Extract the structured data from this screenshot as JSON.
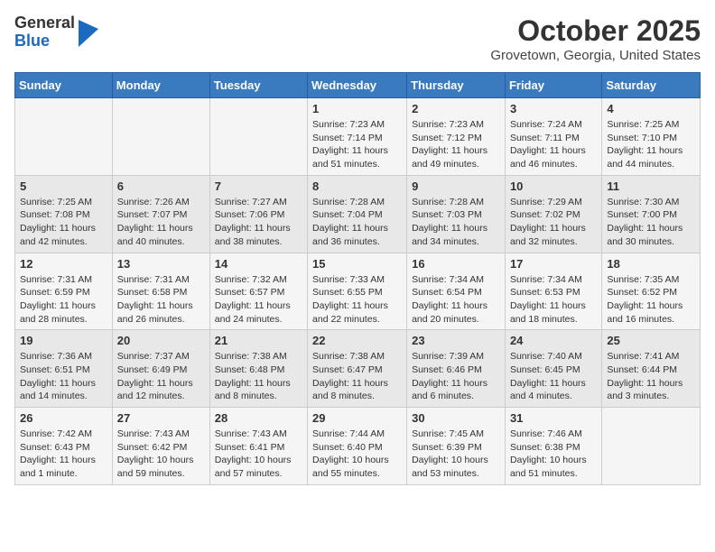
{
  "header": {
    "logo_general": "General",
    "logo_blue": "Blue",
    "month": "October 2025",
    "location": "Grovetown, Georgia, United States"
  },
  "days_of_week": [
    "Sunday",
    "Monday",
    "Tuesday",
    "Wednesday",
    "Thursday",
    "Friday",
    "Saturday"
  ],
  "weeks": [
    [
      {
        "day": "",
        "content": ""
      },
      {
        "day": "",
        "content": ""
      },
      {
        "day": "",
        "content": ""
      },
      {
        "day": "1",
        "content": "Sunrise: 7:23 AM\nSunset: 7:14 PM\nDaylight: 11 hours and 51 minutes."
      },
      {
        "day": "2",
        "content": "Sunrise: 7:23 AM\nSunset: 7:12 PM\nDaylight: 11 hours and 49 minutes."
      },
      {
        "day": "3",
        "content": "Sunrise: 7:24 AM\nSunset: 7:11 PM\nDaylight: 11 hours and 46 minutes."
      },
      {
        "day": "4",
        "content": "Sunrise: 7:25 AM\nSunset: 7:10 PM\nDaylight: 11 hours and 44 minutes."
      }
    ],
    [
      {
        "day": "5",
        "content": "Sunrise: 7:25 AM\nSunset: 7:08 PM\nDaylight: 11 hours and 42 minutes."
      },
      {
        "day": "6",
        "content": "Sunrise: 7:26 AM\nSunset: 7:07 PM\nDaylight: 11 hours and 40 minutes."
      },
      {
        "day": "7",
        "content": "Sunrise: 7:27 AM\nSunset: 7:06 PM\nDaylight: 11 hours and 38 minutes."
      },
      {
        "day": "8",
        "content": "Sunrise: 7:28 AM\nSunset: 7:04 PM\nDaylight: 11 hours and 36 minutes."
      },
      {
        "day": "9",
        "content": "Sunrise: 7:28 AM\nSunset: 7:03 PM\nDaylight: 11 hours and 34 minutes."
      },
      {
        "day": "10",
        "content": "Sunrise: 7:29 AM\nSunset: 7:02 PM\nDaylight: 11 hours and 32 minutes."
      },
      {
        "day": "11",
        "content": "Sunrise: 7:30 AM\nSunset: 7:00 PM\nDaylight: 11 hours and 30 minutes."
      }
    ],
    [
      {
        "day": "12",
        "content": "Sunrise: 7:31 AM\nSunset: 6:59 PM\nDaylight: 11 hours and 28 minutes."
      },
      {
        "day": "13",
        "content": "Sunrise: 7:31 AM\nSunset: 6:58 PM\nDaylight: 11 hours and 26 minutes."
      },
      {
        "day": "14",
        "content": "Sunrise: 7:32 AM\nSunset: 6:57 PM\nDaylight: 11 hours and 24 minutes."
      },
      {
        "day": "15",
        "content": "Sunrise: 7:33 AM\nSunset: 6:55 PM\nDaylight: 11 hours and 22 minutes."
      },
      {
        "day": "16",
        "content": "Sunrise: 7:34 AM\nSunset: 6:54 PM\nDaylight: 11 hours and 20 minutes."
      },
      {
        "day": "17",
        "content": "Sunrise: 7:34 AM\nSunset: 6:53 PM\nDaylight: 11 hours and 18 minutes."
      },
      {
        "day": "18",
        "content": "Sunrise: 7:35 AM\nSunset: 6:52 PM\nDaylight: 11 hours and 16 minutes."
      }
    ],
    [
      {
        "day": "19",
        "content": "Sunrise: 7:36 AM\nSunset: 6:51 PM\nDaylight: 11 hours and 14 minutes."
      },
      {
        "day": "20",
        "content": "Sunrise: 7:37 AM\nSunset: 6:49 PM\nDaylight: 11 hours and 12 minutes."
      },
      {
        "day": "21",
        "content": "Sunrise: 7:38 AM\nSunset: 6:48 PM\nDaylight: 11 hours and 8 minutes."
      },
      {
        "day": "22",
        "content": "Sunrise: 7:38 AM\nSunset: 6:47 PM\nDaylight: 11 hours and 8 minutes."
      },
      {
        "day": "23",
        "content": "Sunrise: 7:39 AM\nSunset: 6:46 PM\nDaylight: 11 hours and 6 minutes."
      },
      {
        "day": "24",
        "content": "Sunrise: 7:40 AM\nSunset: 6:45 PM\nDaylight: 11 hours and 4 minutes."
      },
      {
        "day": "25",
        "content": "Sunrise: 7:41 AM\nSunset: 6:44 PM\nDaylight: 11 hours and 3 minutes."
      }
    ],
    [
      {
        "day": "26",
        "content": "Sunrise: 7:42 AM\nSunset: 6:43 PM\nDaylight: 11 hours and 1 minute."
      },
      {
        "day": "27",
        "content": "Sunrise: 7:43 AM\nSunset: 6:42 PM\nDaylight: 10 hours and 59 minutes."
      },
      {
        "day": "28",
        "content": "Sunrise: 7:43 AM\nSunset: 6:41 PM\nDaylight: 10 hours and 57 minutes."
      },
      {
        "day": "29",
        "content": "Sunrise: 7:44 AM\nSunset: 6:40 PM\nDaylight: 10 hours and 55 minutes."
      },
      {
        "day": "30",
        "content": "Sunrise: 7:45 AM\nSunset: 6:39 PM\nDaylight: 10 hours and 53 minutes."
      },
      {
        "day": "31",
        "content": "Sunrise: 7:46 AM\nSunset: 6:38 PM\nDaylight: 10 hours and 51 minutes."
      },
      {
        "day": "",
        "content": ""
      }
    ]
  ]
}
